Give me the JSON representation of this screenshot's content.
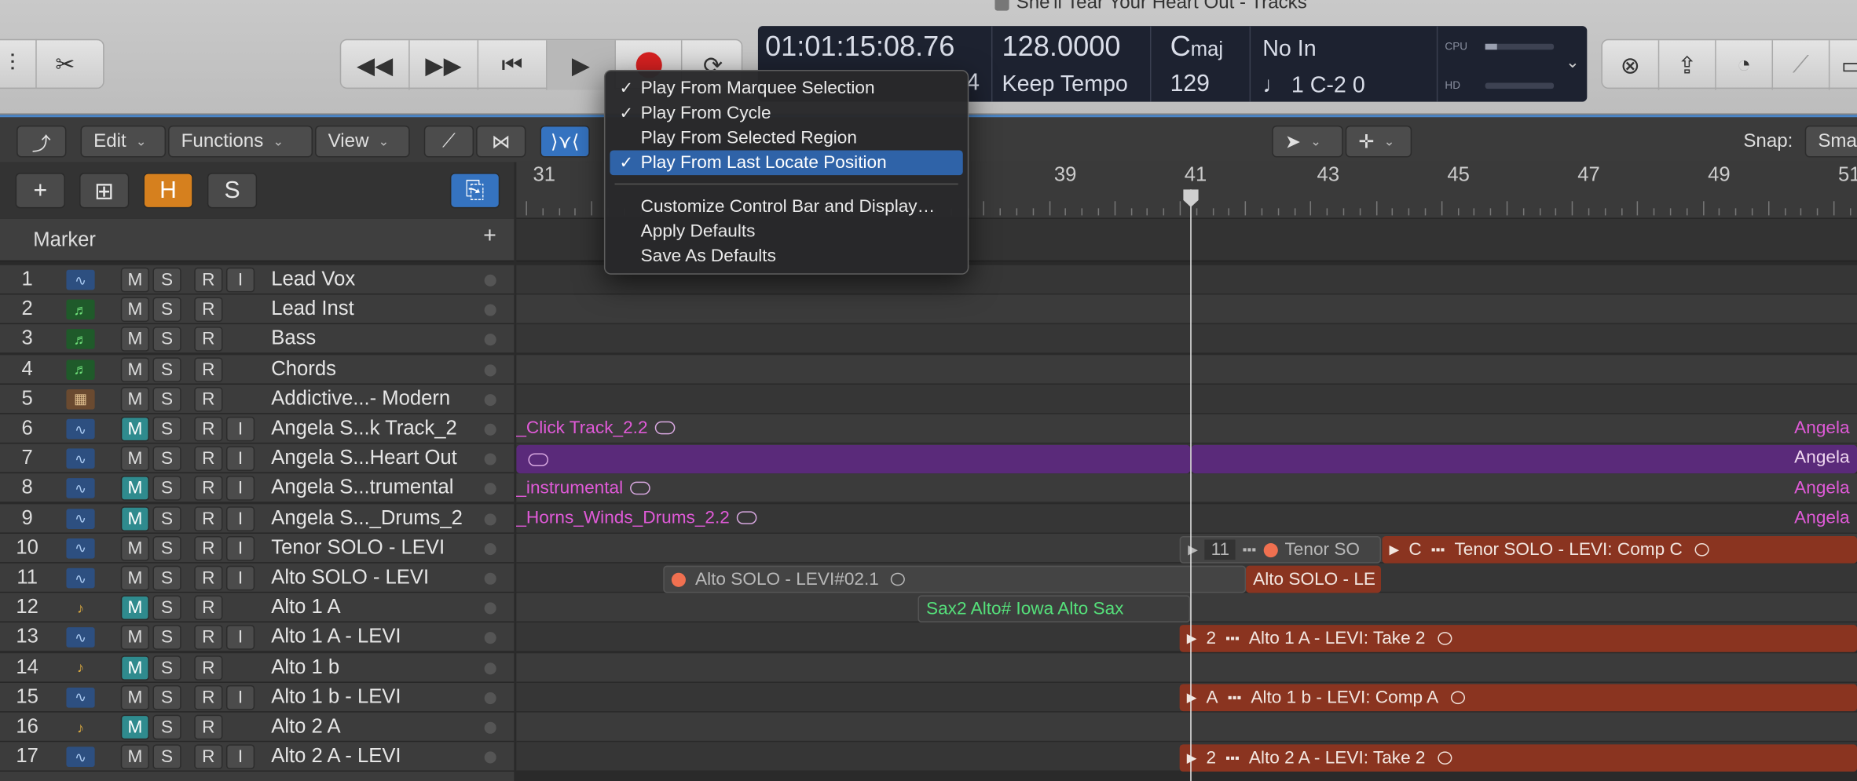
{
  "window": {
    "title": "She'll Tear Your Heart Out - Tracks"
  },
  "lcd": {
    "timecode": "01:01:15:08.76",
    "bar_tail": "4",
    "tempo": "128.0000",
    "tempo_mode": "Keep Tempo",
    "key_root": "C",
    "key_mode": "maj",
    "time_sig": "129",
    "midi_in": "No In",
    "midi_note": "♩ 1 C-2  0",
    "cpu_label": "CPU",
    "hd_label": "HD"
  },
  "toolbar": {
    "edit": "Edit",
    "functions": "Functions",
    "view": "View",
    "snap_label": "Snap:",
    "snap_value": "Sma"
  },
  "header_buttons": {
    "add": "+",
    "hide": "H",
    "solo": "S"
  },
  "marker": {
    "label": "Marker",
    "add": "+"
  },
  "ruler": {
    "bars": [
      "31",
      "39",
      "41",
      "43",
      "45",
      "47",
      "49",
      "51"
    ]
  },
  "menu": {
    "items": [
      {
        "label": "Play From Marquee Selection",
        "checked": "✓"
      },
      {
        "label": "Play From Cycle",
        "checked": "✓"
      },
      {
        "label": "Play From Selected Region",
        "checked": ""
      },
      {
        "label": "Play From Last Locate Position",
        "checked": "✓"
      },
      {
        "label": "Customize Control Bar and Display…",
        "checked": ""
      },
      {
        "label": "Apply Defaults",
        "checked": ""
      },
      {
        "label": "Save As Defaults",
        "checked": ""
      }
    ]
  },
  "track_buttons": {
    "m": "M",
    "s": "S",
    "r": "R",
    "i": "I"
  },
  "tracks": [
    {
      "num": "1",
      "name": "Lead Vox"
    },
    {
      "num": "2",
      "name": "Lead Inst"
    },
    {
      "num": "3",
      "name": "Bass"
    },
    {
      "num": "4",
      "name": "Chords"
    },
    {
      "num": "5",
      "name": "Addictive...- Modern"
    },
    {
      "num": "6",
      "name": "Angela S...k Track_2"
    },
    {
      "num": "7",
      "name": "Angela S...Heart Out"
    },
    {
      "num": "8",
      "name": "Angela S...trumental"
    },
    {
      "num": "9",
      "name": "Angela S..._Drums_2"
    },
    {
      "num": "10",
      "name": "Tenor SOLO - LEVI"
    },
    {
      "num": "11",
      "name": "Alto SOLO - LEVI"
    },
    {
      "num": "12",
      "name": "Alto 1 A"
    },
    {
      "num": "13",
      "name": "Alto 1 A - LEVI"
    },
    {
      "num": "14",
      "name": "Alto 1 b"
    },
    {
      "num": "15",
      "name": "Alto 1 b - LEVI"
    },
    {
      "num": "16",
      "name": "Alto 2 A"
    },
    {
      "num": "17",
      "name": "Alto 2 A - LEVI"
    }
  ],
  "regions": {
    "r6": "_Click Track_2.2",
    "r6_right": "Angela",
    "r7_right": "Angela",
    "r8": "_instrumental",
    "r8_right": "Angela",
    "r9": "_Horns_Winds_Drums_2.2",
    "r9_right": "Angela",
    "r10_a_num": "11",
    "r10_a": "Tenor SO",
    "r10_b_take": "C",
    "r10_b": "Tenor SOLO - LEVI: Comp C",
    "r11_a": "Alto SOLO - LEVI#02.1",
    "r11_b": "Alto SOLO - LE",
    "r12": "Sax2 Alto# Iowa Alto Sax",
    "r13_take": "2",
    "r13": "Alto 1 A - LEVI: Take 2",
    "r15_take": "A",
    "r15": "Alto 1 b - LEVI: Comp A",
    "r17_take": "2",
    "r17": "Alto 2 A - LEVI: Take 2"
  }
}
